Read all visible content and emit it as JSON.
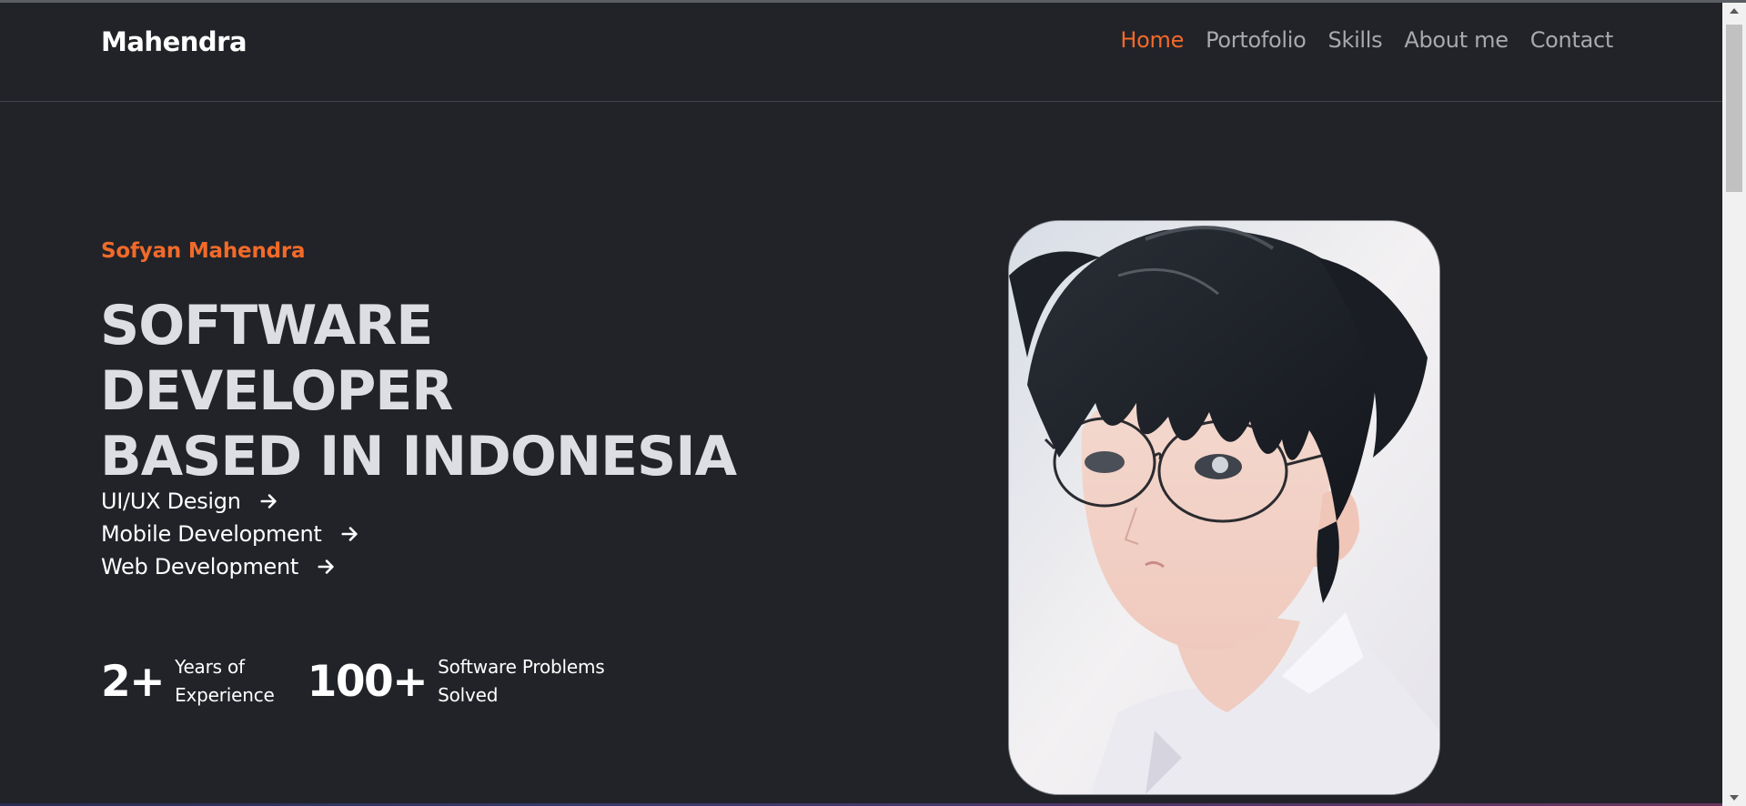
{
  "header": {
    "brand": "Mahendra",
    "nav": [
      {
        "label": "Home",
        "active": true
      },
      {
        "label": "Portofolio",
        "active": false
      },
      {
        "label": "Skills",
        "active": false
      },
      {
        "label": "About me",
        "active": false
      },
      {
        "label": "Contact",
        "active": false
      }
    ]
  },
  "hero": {
    "name": "Sofyan Mahendra",
    "headline": [
      "SOFTWARE DEVELOPER",
      "BASED IN INDONESIA"
    ],
    "services": [
      {
        "label": "UI/UX Design",
        "icon": "arrow-right-icon"
      },
      {
        "label": "Mobile Development",
        "icon": "arrow-right-icon"
      },
      {
        "label": "Web Development",
        "icon": "arrow-right-icon"
      }
    ],
    "stats": [
      {
        "value": "2+",
        "label": [
          "Years of",
          "Experience"
        ]
      },
      {
        "value": "100+",
        "label": [
          "Software Problems",
          "Solved"
        ]
      }
    ]
  },
  "colors": {
    "accent": "#f26a2a",
    "background": "#212328",
    "headline": "#dcdee3"
  }
}
